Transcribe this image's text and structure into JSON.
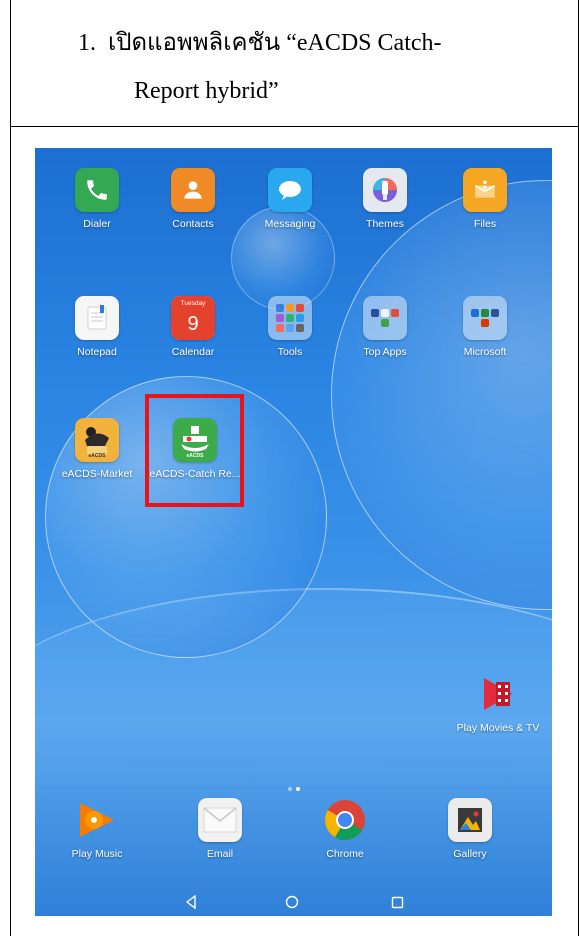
{
  "instruction": {
    "number": "1.",
    "text_line1": "เปิดแอพพลิเคชัน “eACDS Catch-",
    "text_line2": "Report hybrid”"
  },
  "home_screen": {
    "apps_row1": [
      {
        "label": "Dialer",
        "icon": "phone-icon"
      },
      {
        "label": "Contacts",
        "icon": "contacts-icon"
      },
      {
        "label": "Messaging",
        "icon": "chat-bubble-icon"
      },
      {
        "label": "Themes",
        "icon": "paintbrush-icon"
      },
      {
        "label": "Files",
        "icon": "folder-zip-icon"
      }
    ],
    "apps_row2": [
      {
        "label": "Notepad",
        "icon": "notepad-icon"
      },
      {
        "label": "Calendar",
        "icon": "calendar-icon",
        "day_name": "Tuesday",
        "day_number": "9"
      },
      {
        "label": "Tools",
        "icon": "folder-icon"
      },
      {
        "label": "Top Apps",
        "icon": "folder-icon"
      },
      {
        "label": "Microsoft",
        "icon": "folder-icon"
      }
    ],
    "apps_row3": [
      {
        "label": "eACDS-Market",
        "icon": "eacds-market-icon",
        "icon_caption": "eACDS"
      },
      {
        "label": "eACDS-Catch Re...",
        "icon": "eacds-catch-icon",
        "icon_caption": "eACDS",
        "highlighted": true
      }
    ],
    "widget": {
      "label": "Play Movies & TV",
      "icon": "play-movies-icon"
    },
    "page_indicator": {
      "pages": 2,
      "current": 2
    },
    "dock": [
      {
        "label": "Play Music",
        "icon": "play-music-icon"
      },
      {
        "label": "Email",
        "icon": "envelope-icon"
      },
      {
        "label": "Chrome",
        "icon": "chrome-icon"
      },
      {
        "label": "Gallery",
        "icon": "gallery-icon"
      }
    ],
    "nav_bar": {
      "back": "back-icon",
      "home": "home-icon",
      "recents": "recents-icon"
    }
  },
  "colors": {
    "highlight_border": "#e8141b",
    "wallpaper": "#2a84e2",
    "label_text": "#ffffff"
  }
}
